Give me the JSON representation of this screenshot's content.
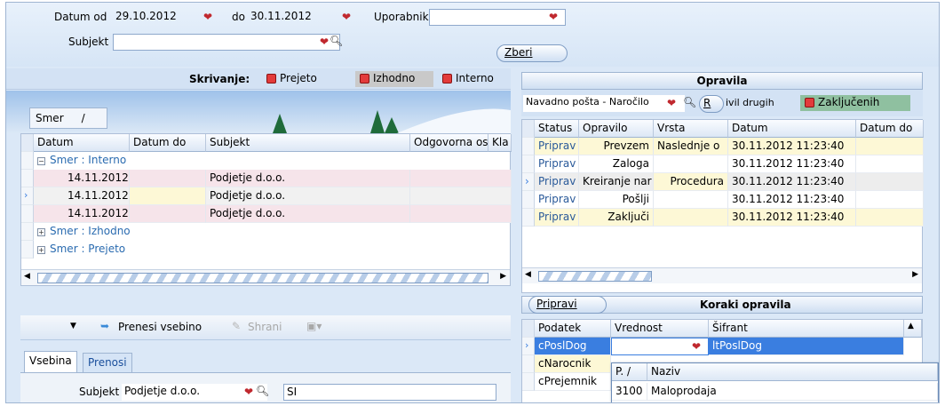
{
  "filters": {
    "datum_od_label": "Datum od",
    "datum_od": "29.10.2012",
    "do_label": "do",
    "datum_do": "30.11.2012",
    "uporabnik_label": "Uporabnik",
    "uporabnik": "",
    "subjekt_label": "Subjekt",
    "subjekt": "",
    "zberi": "Zberi"
  },
  "hiding": {
    "label": "Skrivanje:",
    "prejeto": "Prejeto",
    "izhodno": "Izhodno",
    "interno": "Interno"
  },
  "group_panel": {
    "chip": "Smer",
    "sort": "/"
  },
  "left_grid": {
    "columns": [
      "Datum",
      "Datum do",
      "Subjekt",
      "Odgovorna os",
      "Kla"
    ],
    "groups": [
      {
        "label": "Smer : Interno",
        "expanded": true
      },
      {
        "label": "Smer : Izhodno",
        "expanded": false
      },
      {
        "label": "Smer : Prejeto",
        "expanded": false
      }
    ],
    "rows": [
      {
        "datum": "14.11.2012 '",
        "datum_do": "",
        "subjekt": "Podjetje d.o.o."
      },
      {
        "datum": "14.11.2012 '",
        "datum_do": "",
        "subjekt": "Podjetje d.o.o."
      },
      {
        "datum": "14.11.2012 '",
        "datum_do": "",
        "subjekt": "Podjetje d.o.o."
      }
    ]
  },
  "opravila": {
    "title": "Opravila",
    "filter": "Navadno pošta - Naročilo",
    "btn_r": "R",
    "drugih": "ivil drugih",
    "zakljucenih": "Zaključenih",
    "columns": [
      "Status",
      "Opravilo",
      "Vrsta",
      "Datum",
      "Datum do"
    ],
    "rows": [
      {
        "status": "Priprav",
        "opravilo": "Prevzem",
        "vrsta": "Naslednje o",
        "datum": "30.11.2012 11:23:40",
        "datum_do": ""
      },
      {
        "status": "Priprav",
        "opravilo": "Zaloga",
        "vrsta": "",
        "datum": "30.11.2012 11:23:40",
        "datum_do": ""
      },
      {
        "status": "Priprav",
        "opravilo": "Kreiranje nar",
        "vrsta": "Procedura",
        "datum": "30.11.2012 11:23:40",
        "datum_do": ""
      },
      {
        "status": "Priprav",
        "opravilo": "Pošlji",
        "vrsta": "",
        "datum": "30.11.2012 11:23:40",
        "datum_do": ""
      },
      {
        "status": "Priprav",
        "opravilo": "Zaključi",
        "vrsta": "",
        "datum": "30.11.2012 11:23:40",
        "datum_do": ""
      }
    ]
  },
  "koraki": {
    "title": "Koraki opravila",
    "pripravi": "Pripravi",
    "columns": [
      "Podatek",
      "Vrednost",
      "Šifrant"
    ],
    "rows": [
      {
        "podatek": "cPoslDog",
        "vrednost": "",
        "sifrant": "ltPoslDog"
      },
      {
        "podatek": "cNarocnik",
        "vrednost": "",
        "sifrant": ""
      },
      {
        "podatek": "cPrejemnik",
        "vrednost": "",
        "sifrant": ""
      }
    ],
    "dropdown": {
      "col1": "P.",
      "sort": "/",
      "col2": "Naziv",
      "rows": [
        {
          "p": "3100",
          "naziv": "Maloprodaja"
        }
      ]
    }
  },
  "editor": {
    "prenesi": "Prenesi vsebino",
    "shrani": "Shrani",
    "tab_vsebina": "Vsebina",
    "tab_prenosi": "Prenosi",
    "subjekt_label": "Subjekt",
    "subjekt": "Podjetje d.o.o.",
    "code": "SI"
  },
  "colors": {
    "accent": "#2a6bb0",
    "pink_row": "#f6e4ea",
    "yellow_row": "#fdf8d6",
    "selection": "#3a7ee0"
  }
}
